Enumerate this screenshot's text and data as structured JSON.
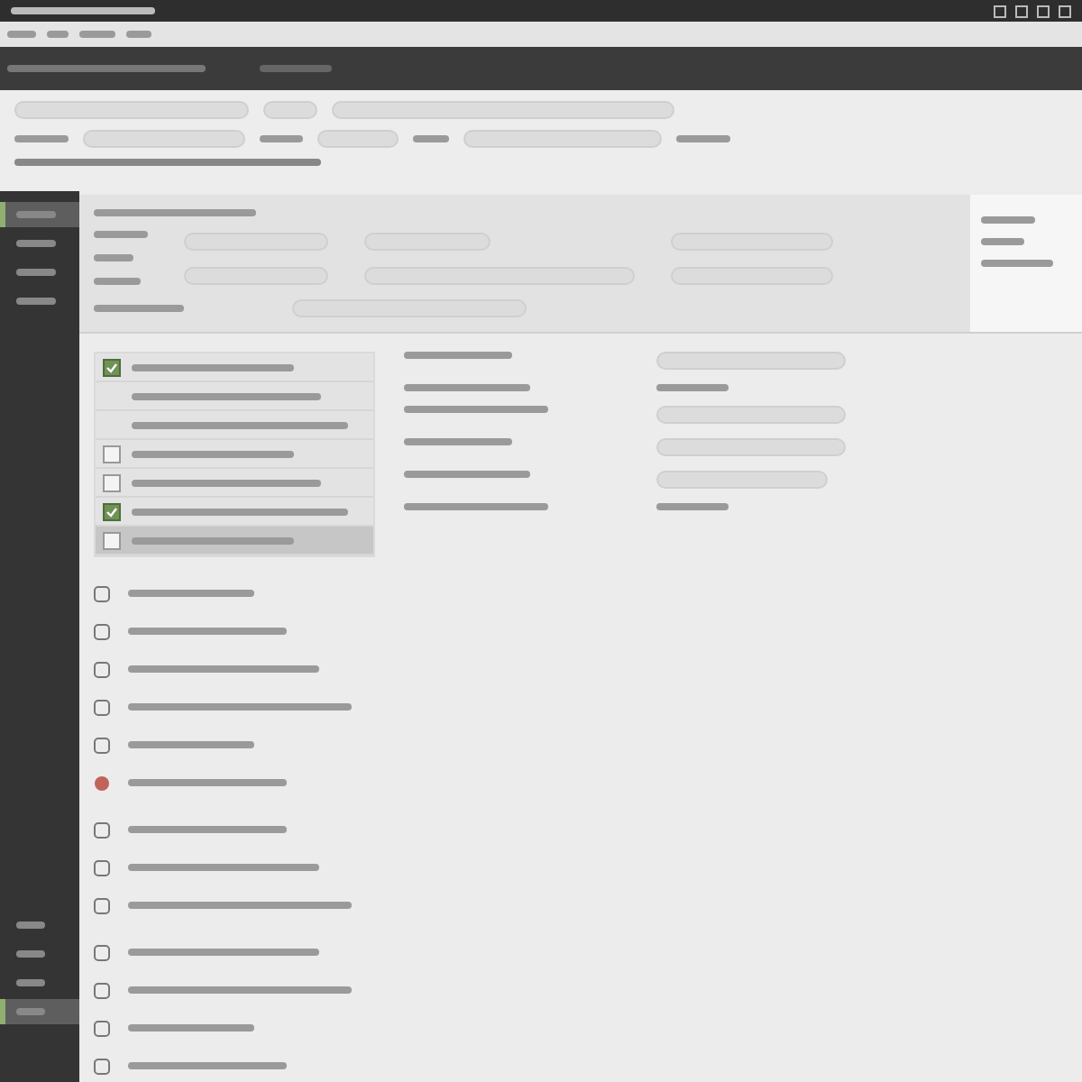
{
  "sidebar": {
    "items": [
      {
        "selected": true
      },
      {
        "selected": false
      },
      {
        "selected": false
      },
      {
        "selected": false
      }
    ],
    "bottom_items": [
      {
        "selected": false
      },
      {
        "selected": false
      },
      {
        "selected": false
      },
      {
        "selected": true
      }
    ]
  },
  "list": {
    "rows": [
      {
        "kind": "checkbox",
        "checked": true,
        "selected": false
      },
      {
        "kind": "plain",
        "selected": false
      },
      {
        "kind": "plain",
        "selected": false
      },
      {
        "kind": "checkbox",
        "checked": false,
        "selected": false
      },
      {
        "kind": "checkbox",
        "checked": false,
        "selected": false
      },
      {
        "kind": "checkbox",
        "checked": true,
        "selected": false
      },
      {
        "kind": "checkbox",
        "checked": false,
        "selected": true
      }
    ]
  },
  "form": {
    "rows": [
      {
        "kind": "field"
      },
      {
        "kind": "text"
      },
      {
        "kind": "field"
      },
      {
        "kind": "field"
      },
      {
        "kind": "select"
      },
      {
        "kind": "text"
      }
    ]
  },
  "icon_list": {
    "groups": [
      [
        {
          "kind": "square"
        },
        {
          "kind": "square"
        },
        {
          "kind": "square"
        },
        {
          "kind": "square"
        },
        {
          "kind": "square"
        },
        {
          "kind": "circle"
        }
      ],
      [
        {
          "kind": "square"
        },
        {
          "kind": "square"
        },
        {
          "kind": "square"
        }
      ],
      [
        {
          "kind": "square"
        },
        {
          "kind": "square"
        },
        {
          "kind": "square"
        },
        {
          "kind": "square"
        }
      ]
    ]
  }
}
